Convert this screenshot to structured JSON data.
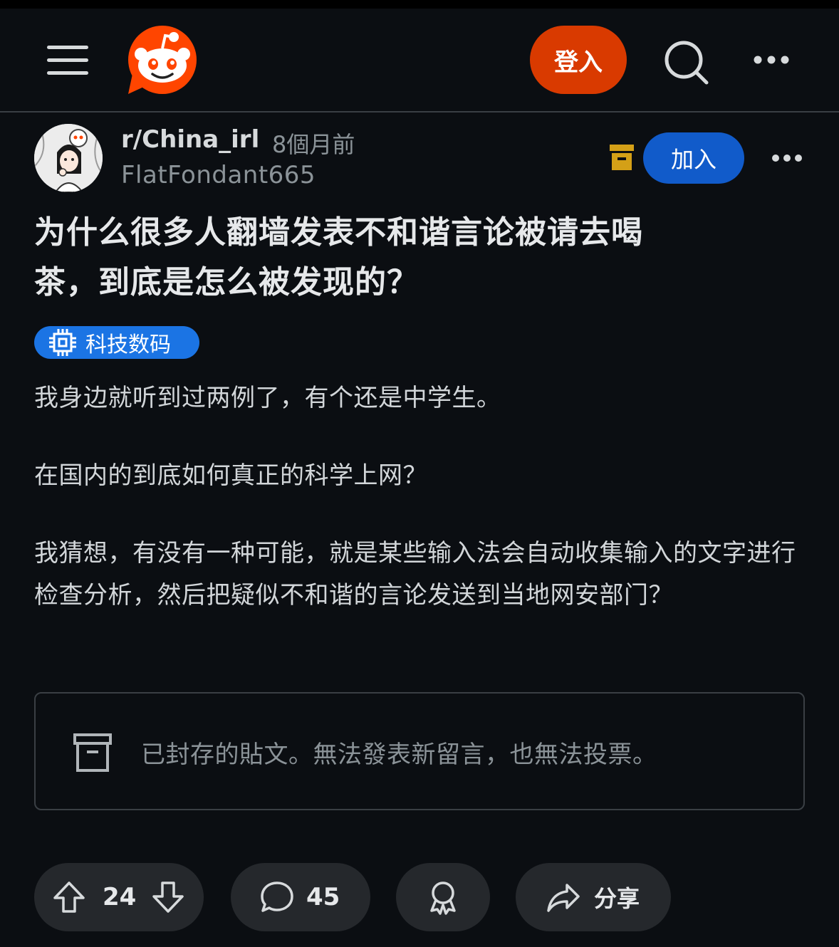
{
  "header": {
    "login_label": "登入"
  },
  "post": {
    "subreddit": "r/China_irl",
    "time": "8個月前",
    "author": "FlatFondant665",
    "join_label": "加入",
    "title_line1": "为什么很多人翻墙发表不和谐言论被请去喝",
    "title_line2": "茶，到底是怎么被发现的？",
    "flair": "科技数码",
    "body": [
      "我身边就听到过两例了，有个还是中学生。",
      "在国内的到底如何真正的科学上网？",
      "我猜想，有没有一种可能，就是某些输入法会自动收集输入的文字进行检查分析，然后把疑似不和谐的言论发送到当地网安部门？"
    ],
    "archived_message": "已封存的貼文。無法發表新留言，也無法投票。"
  },
  "actions": {
    "score": "24",
    "comments": "45",
    "share_label": "分享"
  },
  "colors": {
    "background": "#0b0e12",
    "login_button": "#d93a00",
    "join_button": "#115bca",
    "flair": "#1b74e4",
    "archive_icon": "#d4a017",
    "pill": "#25282c"
  }
}
